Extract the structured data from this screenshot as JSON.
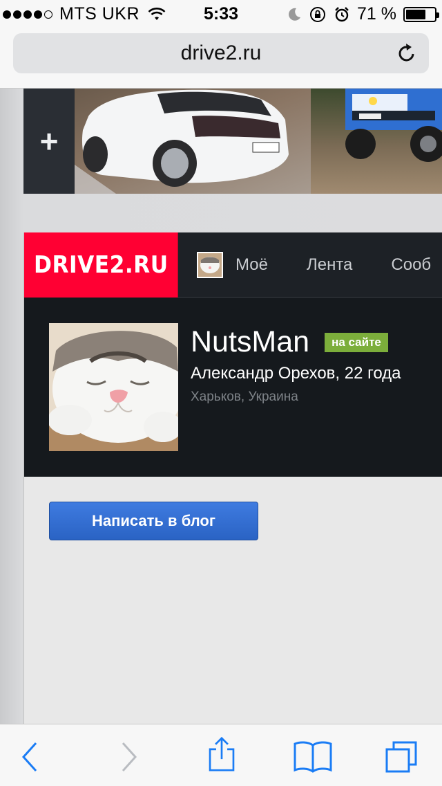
{
  "status_bar": {
    "carrier": "MTS UKR",
    "time": "5:33",
    "battery_percent": "71 %",
    "battery_level": 0.71,
    "signal_bars_filled": 4,
    "signal_bars_total": 5
  },
  "browser": {
    "url": "drive2.ru"
  },
  "gallery": {
    "add_label": "+"
  },
  "site": {
    "logo": "DRIVE2.RU",
    "nav": [
      {
        "label": "Моё"
      },
      {
        "label": "Лента"
      },
      {
        "label": "Сооб"
      }
    ]
  },
  "profile": {
    "username": "NutsMan",
    "status_badge": "на сайте",
    "full_name_age": "Александр Орехов, 22 года",
    "location": "Харьков, Украина"
  },
  "actions": {
    "write_blog": "Написать в блог"
  },
  "colors": {
    "brand_red": "#ff0033",
    "nav_bg": "#1d2126",
    "online_green": "#7cae3b",
    "button_blue": "#2f6ccf",
    "ios_blue": "#1a7cf5"
  }
}
